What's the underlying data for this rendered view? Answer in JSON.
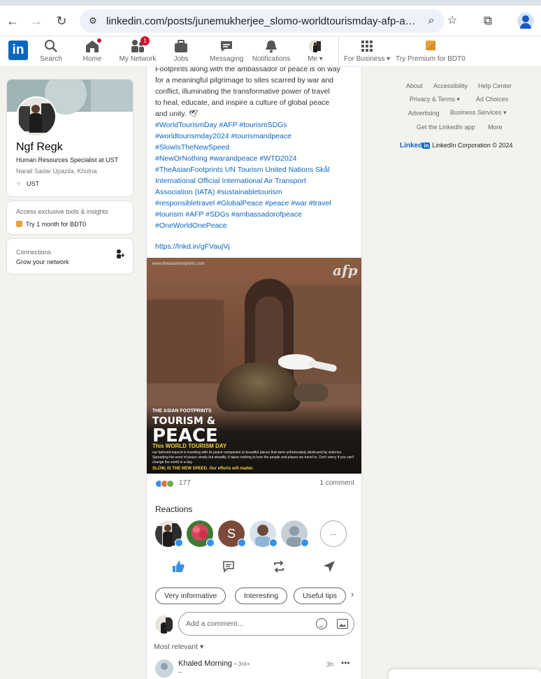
{
  "browser": {
    "url": "linkedin.com/posts/junemukherjee_slomo-worldtourismday-afp-activi...",
    "icons": [
      "back-icon",
      "forward-icon",
      "reload-icon",
      "site-info-icon",
      "zoom-icon",
      "star-icon",
      "extensions-icon",
      "profile-icon"
    ]
  },
  "nav": {
    "logo": "in",
    "items": [
      {
        "label": "Search"
      },
      {
        "label": "Home"
      },
      {
        "label": "My Network",
        "badge": "1"
      },
      {
        "label": "Jobs"
      },
      {
        "label": "Messaging"
      },
      {
        "label": "Notifications"
      },
      {
        "label": "Me ▾"
      },
      {
        "label": "For Business ▾"
      },
      {
        "label": "Try Premium for BDT0"
      }
    ]
  },
  "profile": {
    "name": "Ngf Regk",
    "headline": "Human Resources Specialist at UST",
    "location": "Narail Sadar Upazila, Khulna",
    "company": "UST"
  },
  "premium": {
    "line1": "Access exclusive tools & insights",
    "line2": "Try 1 month for BDT0"
  },
  "connections": {
    "line1": "Connections",
    "line2": "Grow your network"
  },
  "post": {
    "text_lines": [
      "Footprints along with the ambassador of peace is on way",
      "for a meaningful pilgrimage to sites scarred by war and",
      "conflict, illuminating the transformative power of travel",
      "to heal, educate, and inspire a culture of global peace",
      "and unity. 🕊"
    ],
    "hashtag_lines": [
      "#WorldTourismDay #AFP #tourismSDGs",
      "#worldtourismday2024 #tourismandpeace",
      "#SlowIsTheNewSpeed",
      "#NewOrNothing #warandpeace #WTD2024",
      "#TheAsianFootprints UN Tourism United Nations Skål",
      "International Official International Air Transport",
      "Association (IATA) #sustainabletourism",
      "#responsibletravel #GlobalPeace #peace #war #travel",
      "#tourism #AFP #SDGs #ambassadorofpeace",
      "#OneWorldOnePeace"
    ],
    "link": "https://lnkd.in/gFVaujVj",
    "image": {
      "watermark": "www.theasianfootprints.com",
      "logo": "afp",
      "tag": "THE ASIAN FOOTPRINTS",
      "title1": "TOURISM &",
      "title2": "PEACE",
      "subtitle": "This WORLD TOURISM DAY",
      "body": "our beloved mascot is traveling with its peace companion to beautiful places that were unfortunately destroyed by violence. Spreading the word of peace slowly but steadily. It takes nothing to love the people and places we travel to. Don't worry if you can't change the world in a day.",
      "footer": "SLOW, IS THE NEW SPEED. Our efforts will matter."
    },
    "reaction_count": "177",
    "comment_count": "1 comment",
    "reactions_title": "Reactions",
    "reactors_more": "...",
    "chips": [
      "Very informative",
      "Interesting",
      "Useful tips"
    ],
    "comment_placeholder": "Add a comment...",
    "sort_label": "Most relevant ▾",
    "comment": {
      "name": "Khaled Morning",
      "degree": "• 3rd+",
      "time": "3h",
      "more": "•••",
      "sub": "--"
    }
  },
  "footer": {
    "links": [
      "About",
      "Accessibility",
      "Help Center",
      "Privacy & Terms ▾",
      "Ad Choices",
      "Advertising",
      "Business Services ▾",
      "Get the LinkedIn app",
      "More"
    ],
    "brand_word": "Linked",
    "brand_mini": "in",
    "copyright": "LinkedIn Corporation © 2024"
  },
  "colors": {
    "accent": "#0a66c2",
    "notification": "#cb112d",
    "background": "#f4f2ee"
  }
}
